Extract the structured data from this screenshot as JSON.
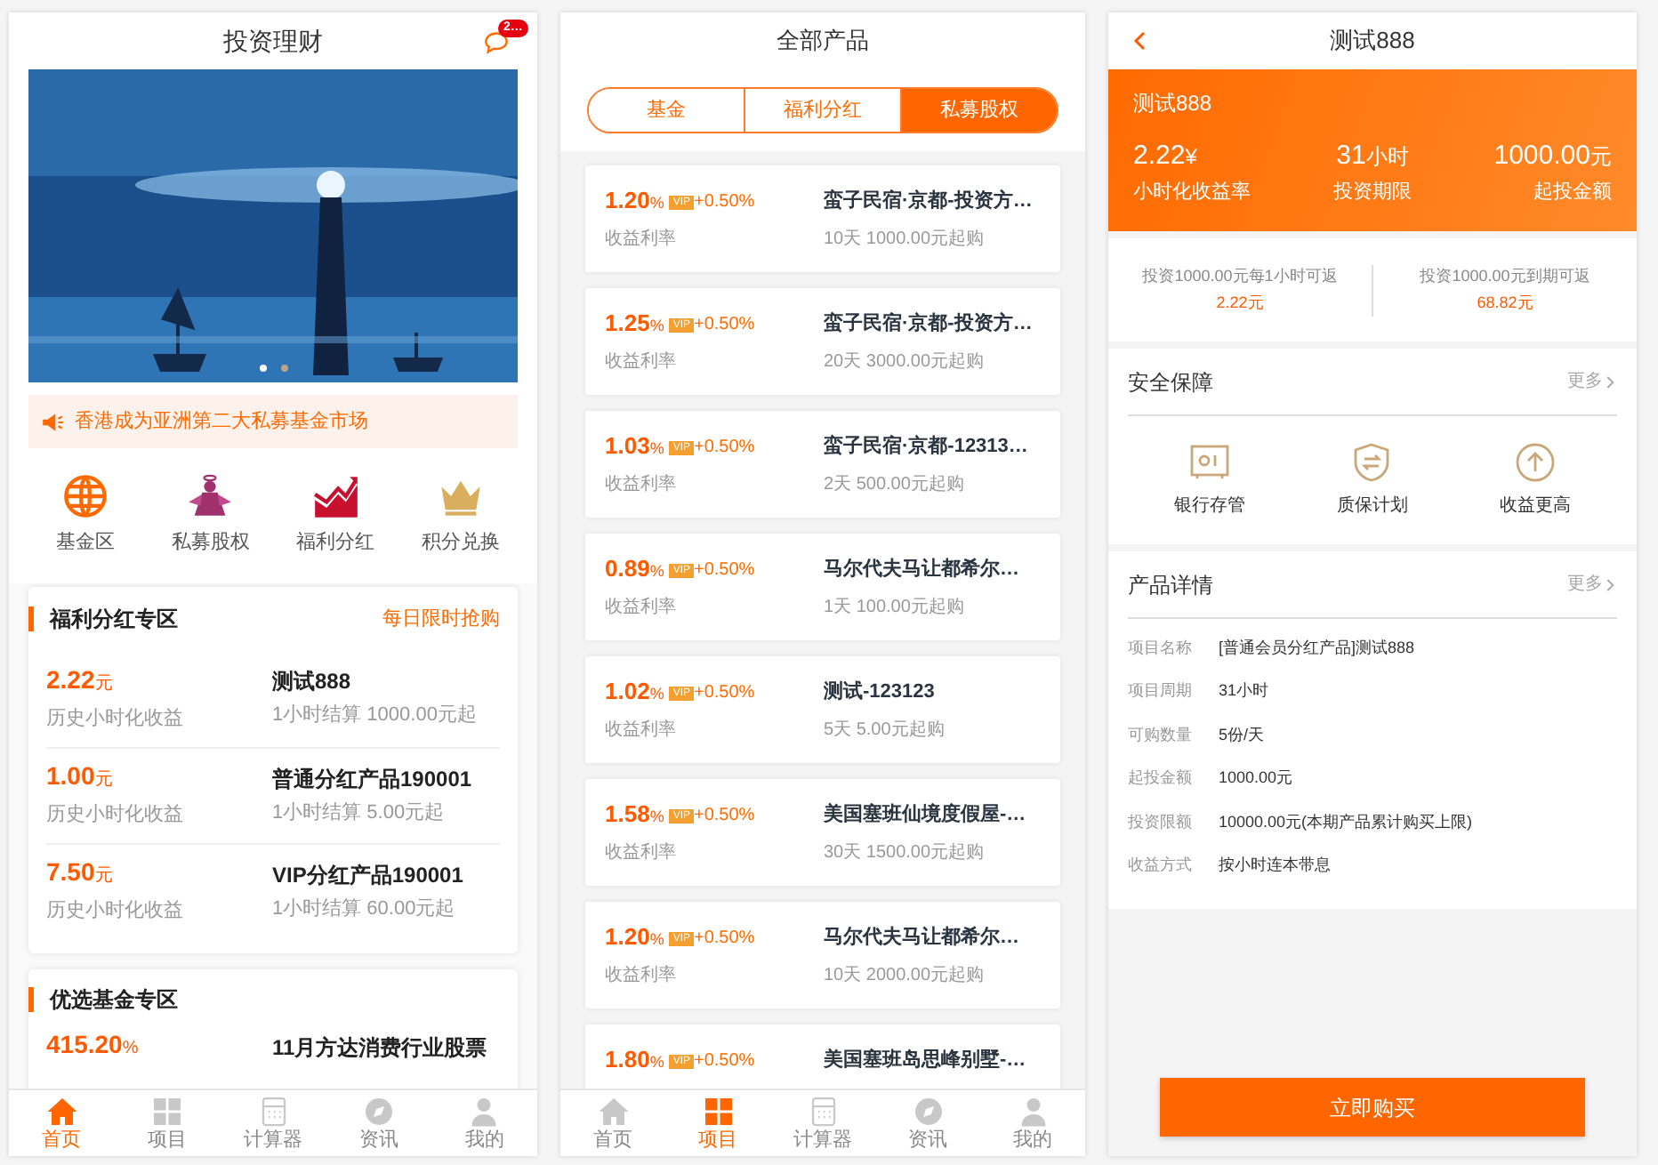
{
  "home": {
    "title": "投资理财",
    "badge": "2…",
    "notice": "香港成为亚洲第二大私募基金市场",
    "shortcuts": [
      {
        "kind": "globe",
        "label": "基金区"
      },
      {
        "kind": "angel",
        "label": "私募股权"
      },
      {
        "kind": "chart",
        "label": "福利分红"
      },
      {
        "kind": "crown",
        "label": "积分兑换"
      }
    ],
    "dividend_section": {
      "title": "福利分红专区",
      "link": "每日限时抢购",
      "items": [
        {
          "yield": "2.22",
          "unit": "元",
          "yield_label": "历史小时化收益",
          "name": "测试888",
          "terms": "1小时结算 1000.00元起"
        },
        {
          "yield": "1.00",
          "unit": "元",
          "yield_label": "历史小时化收益",
          "name": "普通分红产品190001",
          "terms": "1小时结算 5.00元起"
        },
        {
          "yield": "7.50",
          "unit": "元",
          "yield_label": "历史小时化收益",
          "name": "VIP分红产品190001",
          "terms": "1小时结算 60.00元起"
        }
      ]
    },
    "fund_section": {
      "title": "优选基金专区",
      "items": [
        {
          "yield": "415.20",
          "unit": "%",
          "name": "11月方达消费行业股票"
        }
      ]
    },
    "tab_bar": [
      {
        "kind": "home",
        "label": "首页",
        "selected": true
      },
      {
        "kind": "grid",
        "label": "项目",
        "selected": false
      },
      {
        "kind": "calculator",
        "label": "计算器",
        "selected": false
      },
      {
        "kind": "compass",
        "label": "资讯",
        "selected": false
      },
      {
        "kind": "user",
        "label": "我的",
        "selected": false
      }
    ]
  },
  "products": {
    "title": "全部产品",
    "tabs": [
      {
        "label": "基金",
        "selected": false
      },
      {
        "label": "福利分红",
        "selected": false
      },
      {
        "label": "私募股权",
        "selected": true
      }
    ],
    "items": [
      {
        "rate": "1.20",
        "unit": "%",
        "vip": "VIP",
        "bonus": "+0.50%",
        "rate_label": "收益利率",
        "name": "蛮子民宿·京都-投资方…",
        "terms": "10天 1000.00元起购"
      },
      {
        "rate": "1.25",
        "unit": "%",
        "vip": "VIP",
        "bonus": "+0.50%",
        "rate_label": "收益利率",
        "name": "蛮子民宿·京都-投资方…",
        "terms": "20天 3000.00元起购"
      },
      {
        "rate": "1.03",
        "unit": "%",
        "vip": "VIP",
        "bonus": "+0.50%",
        "rate_label": "收益利率",
        "name": "蛮子民宿·京都-12313…",
        "terms": "2天 500.00元起购"
      },
      {
        "rate": "0.89",
        "unit": "%",
        "vip": "VIP",
        "bonus": "+0.50%",
        "rate_label": "收益利率",
        "name": "马尔代夫马让都希尔…",
        "terms": "1天 100.00元起购"
      },
      {
        "rate": "1.02",
        "unit": "%",
        "vip": "VIP",
        "bonus": "+0.50%",
        "rate_label": "收益利率",
        "name": "测试-123123",
        "terms": "5天 5.00元起购"
      },
      {
        "rate": "1.58",
        "unit": "%",
        "vip": "VIP",
        "bonus": "+0.50%",
        "rate_label": "收益利率",
        "name": "美国塞班仙境度假屋-…",
        "terms": "30天 1500.00元起购"
      },
      {
        "rate": "1.20",
        "unit": "%",
        "vip": "VIP",
        "bonus": "+0.50%",
        "rate_label": "收益利率",
        "name": "马尔代夫马让都希尔…",
        "terms": "10天 2000.00元起购"
      },
      {
        "rate": "1.80",
        "unit": "%",
        "vip": "VIP",
        "bonus": "+0.50%",
        "name": "美国塞班岛思峰别墅-…"
      }
    ],
    "tab_bar": [
      {
        "kind": "home",
        "label": "首页",
        "selected": false
      },
      {
        "kind": "grid",
        "label": "项目",
        "selected": true
      },
      {
        "kind": "calculator",
        "label": "计算器",
        "selected": false
      },
      {
        "kind": "compass",
        "label": "资讯",
        "selected": false
      },
      {
        "kind": "user",
        "label": "我的",
        "selected": false
      }
    ]
  },
  "detail": {
    "title": "测试888",
    "hero": {
      "name": "测试888",
      "stats": [
        {
          "value": "2.22",
          "unit": "¥",
          "label": "小时化收益率"
        },
        {
          "value": "31",
          "unit": "小时",
          "label": "投资期限"
        },
        {
          "value": "1000.00",
          "unit": "元",
          "label": "起投金额"
        }
      ]
    },
    "returns": [
      {
        "text": "投资1000.00元每1小时可返",
        "amount": "2.22元"
      },
      {
        "text": "投资1000.00元到期可返",
        "amount": "68.82元"
      }
    ],
    "security": {
      "title": "安全保障",
      "more": "更多",
      "features": [
        {
          "kind": "safe",
          "label": "银行存管"
        },
        {
          "kind": "shield",
          "label": "质保计划"
        },
        {
          "kind": "arrow-up",
          "label": "收益更高"
        }
      ]
    },
    "details": {
      "title": "产品详情",
      "more": "更多",
      "rows": [
        {
          "label": "项目名称",
          "value": "[普通会员分红产品]测试888"
        },
        {
          "label": "项目周期",
          "value": "31小时"
        },
        {
          "label": "可购数量",
          "value": "5份/天"
        },
        {
          "label": "起投金额",
          "value": "1000.00元"
        },
        {
          "label": "投资限额",
          "value": "10000.00元(本期产品累计购买上限)"
        },
        {
          "label": "收益方式",
          "value": "按小时连本带息"
        }
      ]
    },
    "buy_button": "立即购买"
  }
}
